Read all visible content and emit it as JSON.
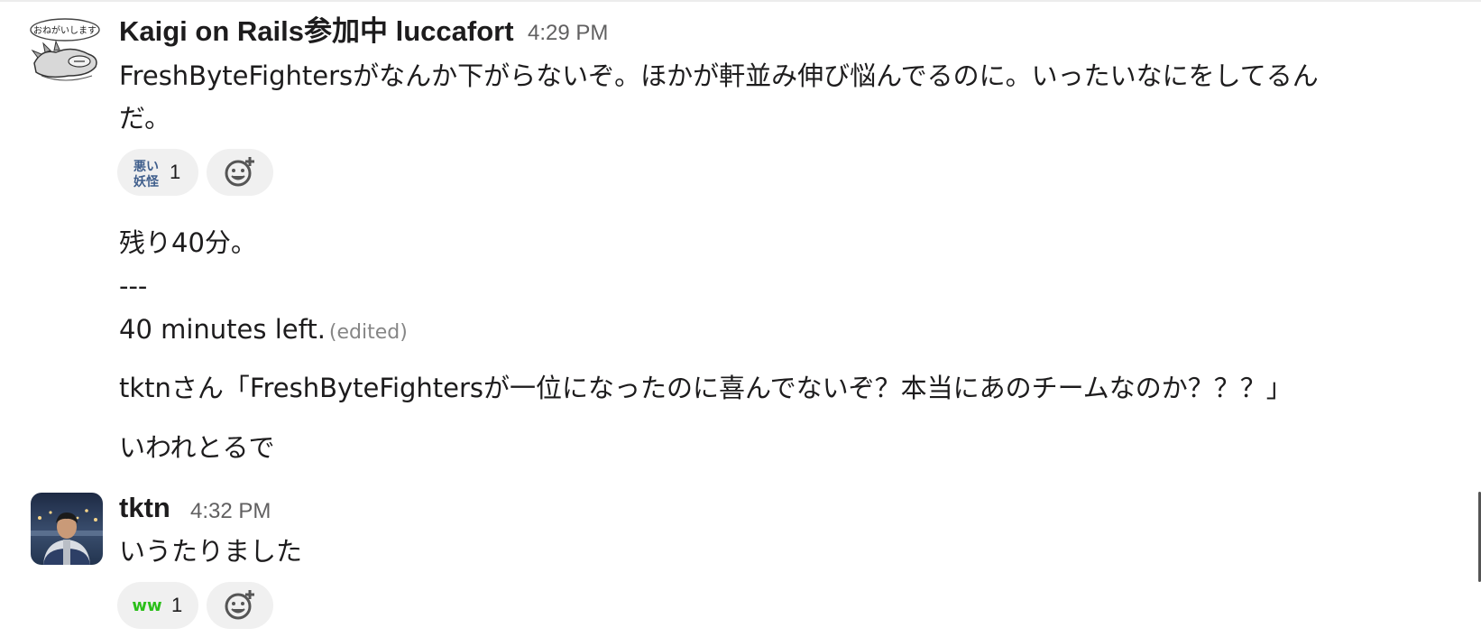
{
  "messages": [
    {
      "author": "Kaigi on Rails参加中 luccafort",
      "time": "4:29 PM",
      "avatar_icon": "sleeping-creature-sticker-avatar",
      "avatar_text": "おねがいします",
      "lines": [
        "FreshByteFightersがなんか下がらないぞ。ほかが軒並み伸び悩んでるのに。いったいなにをしてるん",
        "だ。"
      ],
      "reactions": [
        {
          "emoji_text": [
            "悪い",
            "妖怪"
          ],
          "emoji_color": "#3f5e8c",
          "count": "1"
        }
      ]
    },
    {
      "lines": [
        "残り40分。",
        "---",
        "40 minutes left."
      ],
      "edited_label": "(edited)"
    },
    {
      "lines": [
        "tktnさん「FreshByteFightersが一位になったのに喜んでないぞ？本当にあのチームなのか？？？」"
      ]
    },
    {
      "lines": [
        "いわれとるで"
      ]
    },
    {
      "author": "tktn",
      "time": "4:32 PM",
      "avatar_icon": "person-photo-avatar",
      "lines": [
        "いうたりました"
      ],
      "reactions": [
        {
          "emoji_text": "ww",
          "emoji_color": "#2bbf1a",
          "count": "1"
        }
      ]
    }
  ],
  "add_reaction_icon": "add-reaction-smiley-icon",
  "colors": {
    "text": "#1d1c1d",
    "timestamp": "#616061",
    "reaction_bg": "#f0f0f0",
    "edited": "#868686"
  }
}
